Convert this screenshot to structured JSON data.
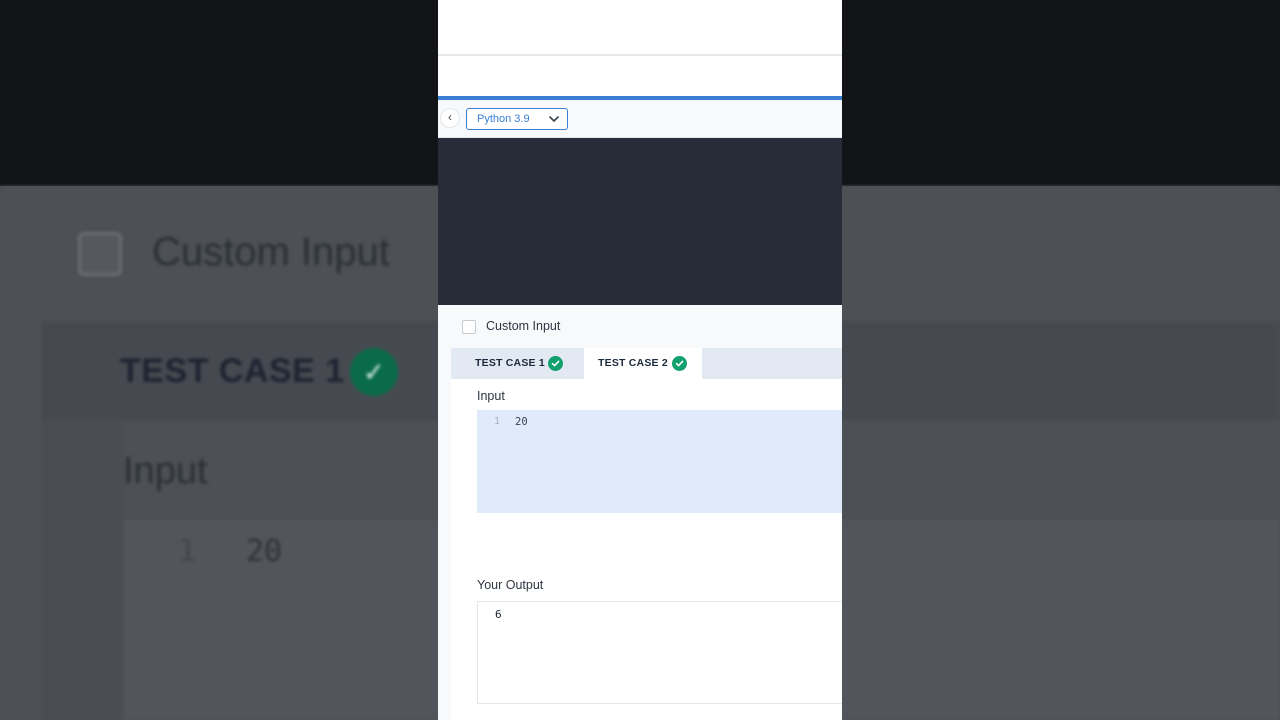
{
  "toolbar": {
    "back_icon": "chevron-left-icon",
    "language": "Python 3.9",
    "dropdown_icon": "chevron-down-icon"
  },
  "custom_input": {
    "label": "Custom Input",
    "checked": false
  },
  "tabs": [
    {
      "label": "TEST CASE 1",
      "status_icon": "check-circle-icon",
      "passed": true,
      "active": false
    },
    {
      "label": "TEST CASE 2",
      "status_icon": "check-circle-icon",
      "passed": true,
      "active": true
    }
  ],
  "input": {
    "label": "Input",
    "lines": [
      {
        "num": "1",
        "text": "20"
      }
    ]
  },
  "output": {
    "label": "Your Output",
    "value": "6"
  },
  "colors": {
    "accent": "#3a7fd5",
    "success": "#12a06e",
    "editor_bg": "#282c38",
    "input_bg": "#dfeafb"
  }
}
